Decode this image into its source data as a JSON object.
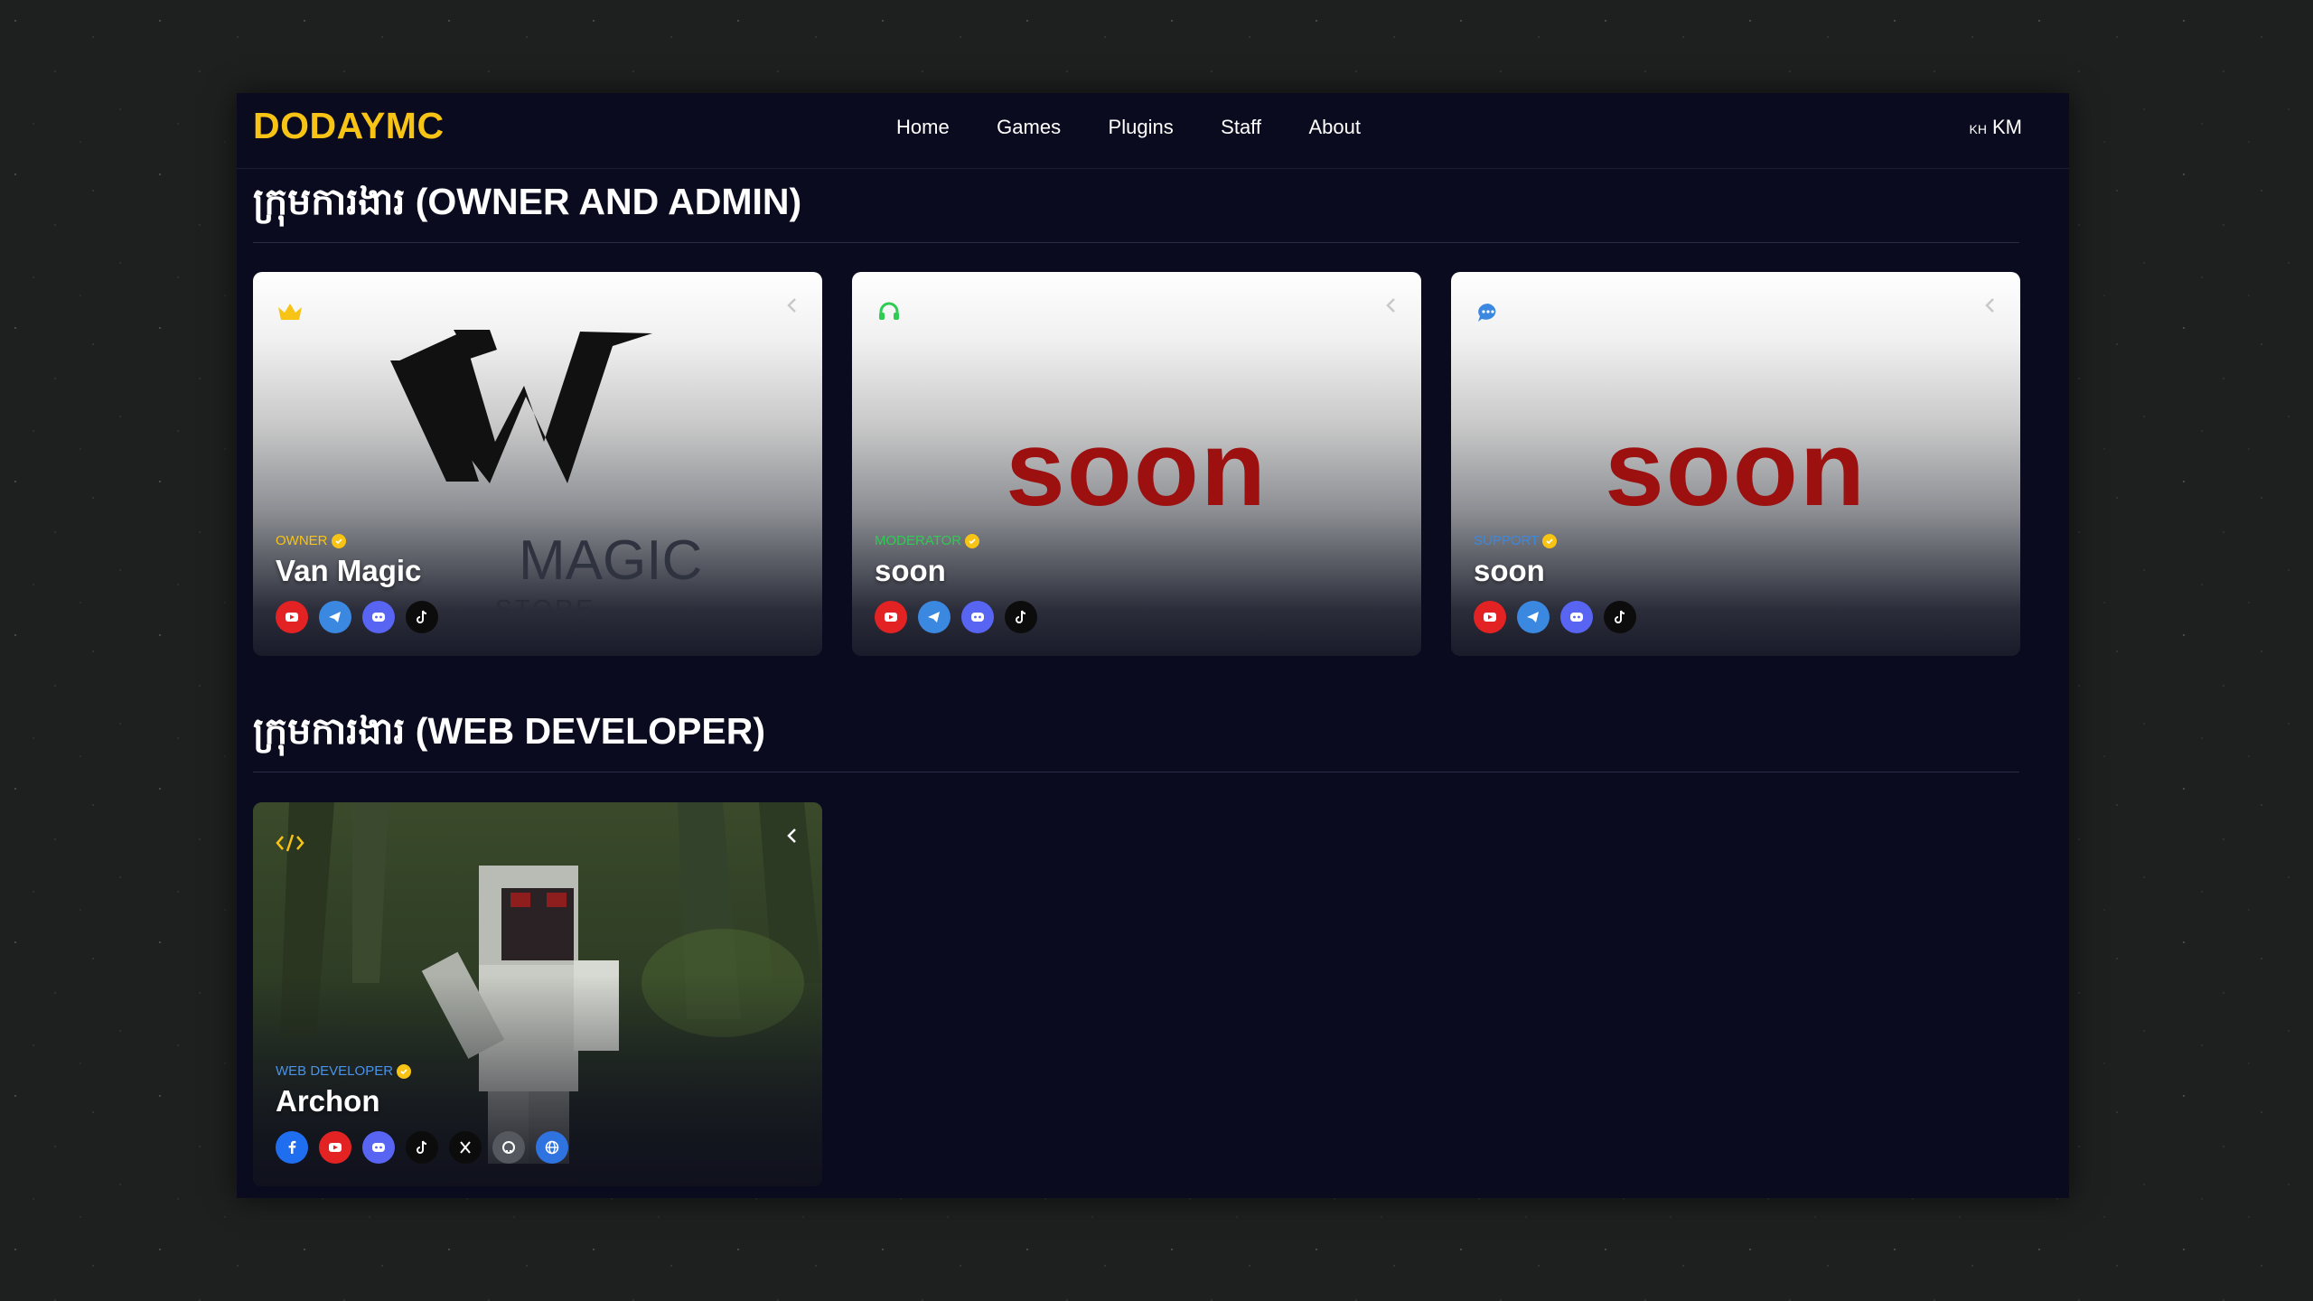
{
  "header": {
    "logo": "DODAYMC",
    "nav": [
      "Home",
      "Games",
      "Plugins",
      "Staff",
      "About"
    ],
    "lang_flag": "KH",
    "lang": "KM"
  },
  "sections": [
    {
      "title": "ក្រុមការងារ (OWNER AND ADMIN)",
      "cards": [
        {
          "role": "OWNER",
          "role_color": "#f7c315",
          "role_icon": "crown-icon",
          "name": "Van Magic",
          "art": {
            "logo_word": "MAGIC",
            "logo_sub": "STORE"
          },
          "socials": [
            "youtube",
            "telegram",
            "discord",
            "tiktok"
          ]
        },
        {
          "role": "MODERATOR",
          "role_color": "#2ecc52",
          "role_icon": "headset-icon",
          "name": "soon",
          "art_text": "soon",
          "socials": [
            "youtube",
            "telegram",
            "discord",
            "tiktok"
          ]
        },
        {
          "role": "SUPPORT",
          "role_color": "#3b88e0",
          "role_icon": "chat-icon",
          "name": "soon",
          "art_text": "soon",
          "socials": [
            "youtube",
            "telegram",
            "discord",
            "tiktok"
          ]
        }
      ]
    },
    {
      "title": "ក្រុមការងារ (WEB DEVELOPER)",
      "cards": [
        {
          "role": "WEB DEVELOPER",
          "role_color": "#3b88e0",
          "role_icon": "code-icon",
          "name": "Archon",
          "socials": [
            "facebook",
            "youtube",
            "discord",
            "tiktok",
            "x",
            "github",
            "website"
          ]
        }
      ]
    }
  ],
  "colors": {
    "accent": "#f7c315",
    "background": "#0b0b1f",
    "soon_red": "#9c1010"
  }
}
